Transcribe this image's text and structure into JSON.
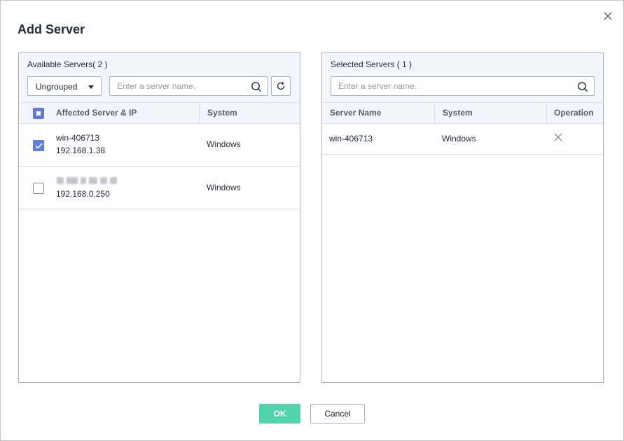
{
  "dialog": {
    "title": "Add Server",
    "close_icon": "close-icon"
  },
  "available": {
    "title": "Available Servers( 2 )",
    "group_select": {
      "selected": "Ungrouped"
    },
    "search": {
      "placeholder": "Enter a server name."
    },
    "columns": {
      "server": "Affected Server & IP",
      "system": "System"
    },
    "rows": [
      {
        "name": "win-406713",
        "ip": "192.168.1.38",
        "system": "Windows",
        "checked": true
      },
      {
        "name": "",
        "ip": "192.168.0.250",
        "system": "Windows",
        "checked": false
      }
    ]
  },
  "selected": {
    "title": "Selected Servers ( 1 )",
    "search": {
      "placeholder": "Enter a server name."
    },
    "columns": {
      "name": "Server Name",
      "system": "System",
      "operation": "Operation"
    },
    "rows": [
      {
        "name": "win-406713",
        "system": "Windows"
      }
    ]
  },
  "footer": {
    "ok_label": "OK",
    "cancel_label": "Cancel"
  },
  "colors": {
    "accent": "#5e7ce0",
    "ok_button": "#50d4ab",
    "header_bg": "#f3f5fc",
    "border": "#adb0b8"
  }
}
